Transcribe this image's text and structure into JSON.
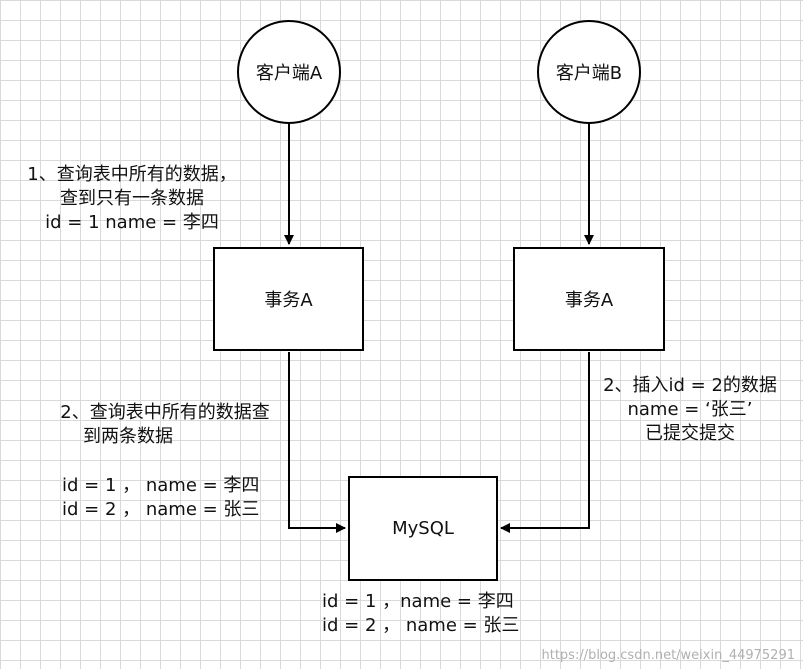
{
  "nodes": {
    "client_a": "客户端A",
    "client_b": "客户端B",
    "txn_a_left": "事务A",
    "txn_a_right": "事务A",
    "mysql": "MySQL"
  },
  "notes": {
    "left_top": [
      "1、查询表中所有的数据，",
      "查到只有一条数据",
      "id = 1 name = 李四"
    ],
    "left_mid": [
      "2、查询表中所有的数据查",
      "到两条数据"
    ],
    "left_bottom": [
      "id = 1 ， name = 李四",
      "id = 2 ，  name = 张三"
    ],
    "right_mid": [
      "2、插入id = 2的数据",
      "name =   ‘张三’",
      "已提交提交"
    ],
    "bottom": [
      "id = 1 ，name = 李四",
      "id = 2 ，  name = 张三"
    ]
  },
  "watermark": "https://blog.csdn.net/weixin_44975291"
}
